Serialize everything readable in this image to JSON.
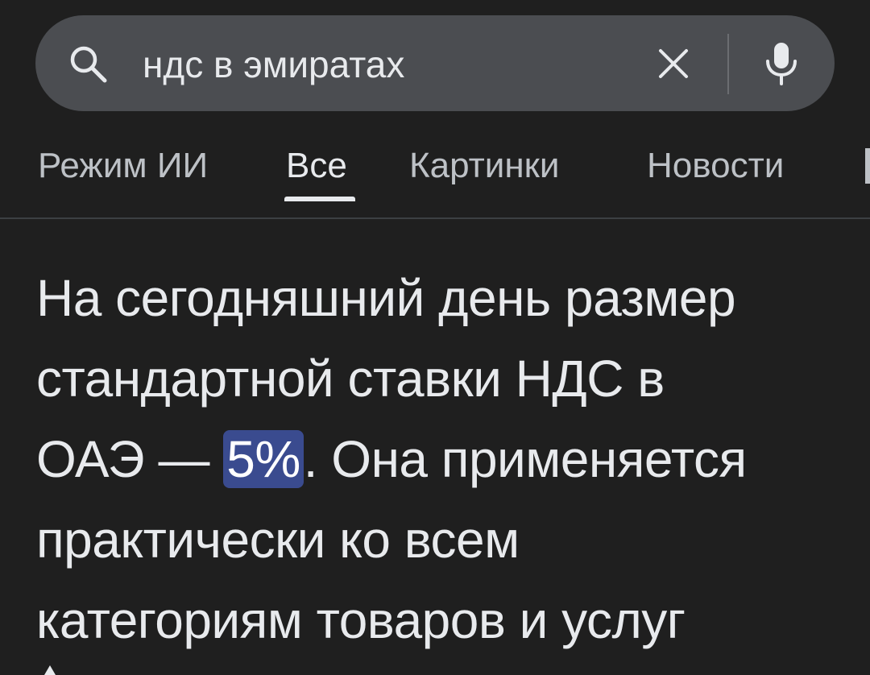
{
  "search": {
    "query": "ндс в эмиратах",
    "icons": {
      "search": "search-icon",
      "clear": "close-icon",
      "voice": "mic-icon"
    }
  },
  "tabs": [
    {
      "label": "Режим ИИ",
      "active": false
    },
    {
      "label": "Все",
      "active": true
    },
    {
      "label": "Картинки",
      "active": false
    },
    {
      "label": "Новости",
      "active": false
    }
  ],
  "answer": {
    "line1": "На сегодняшний день размер",
    "line2": "стандартной ставки НДС в",
    "line3_before": "ОАЭ — ",
    "line3_highlight": "5%",
    "line3_after": ". Она применяется",
    "line4": "практически ко всем",
    "line5": "категориям товаров и услуг"
  },
  "colors": {
    "background": "#1f1f1f",
    "search_bar": "#4b4d51",
    "text": "#e8eaed",
    "tab_inactive": "#bdc1c6",
    "highlight": "#3a4b8f"
  }
}
